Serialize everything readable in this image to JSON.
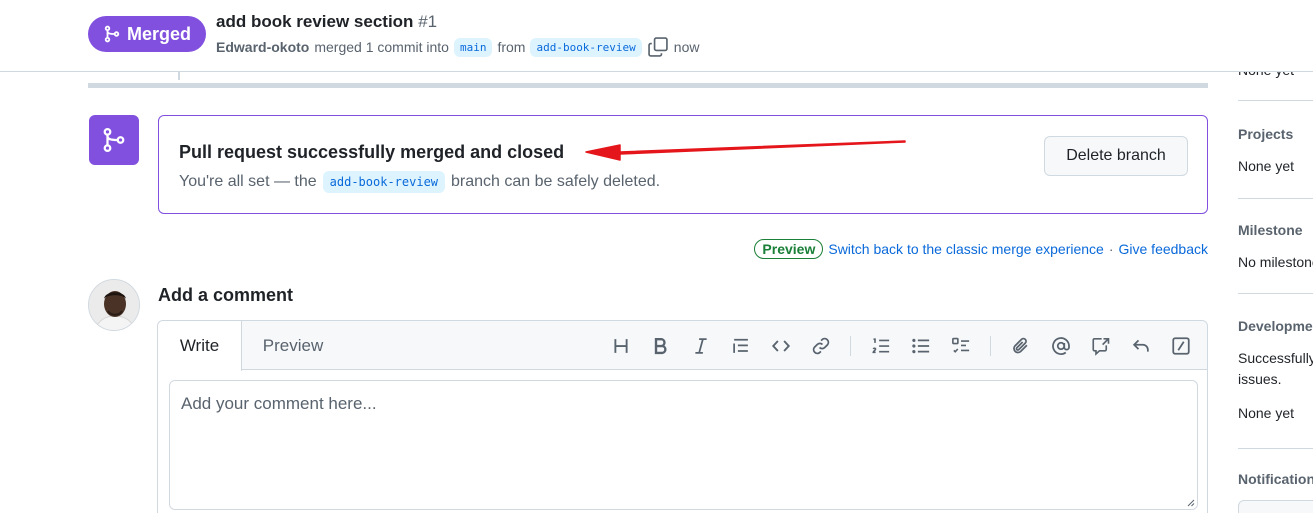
{
  "header": {
    "status_label": "Merged",
    "pr_title": "add book review section",
    "pr_number": "#1",
    "author": "Edward-okoto",
    "merged_text": "merged 1 commit into",
    "base_branch": "main",
    "from_text": "from",
    "head_branch": "add-book-review",
    "time": "now"
  },
  "merge_box": {
    "title": "Pull request successfully merged and closed",
    "desc_before": "You're all set — the",
    "branch": "add-book-review",
    "desc_after": "branch can be safely deleted.",
    "delete_button": "Delete branch"
  },
  "preview_bar": {
    "badge": "Preview",
    "switch_link": "Switch back to the classic merge experience",
    "separator": "·",
    "feedback_link": "Give feedback"
  },
  "comment": {
    "heading": "Add a comment",
    "tab_write": "Write",
    "tab_preview": "Preview",
    "placeholder": "Add your comment here...",
    "toolbar_icons": [
      "heading-icon",
      "bold-icon",
      "italic-icon",
      "quote-icon",
      "code-icon",
      "link-icon",
      "numbered-list-icon",
      "unordered-list-icon",
      "task-list-icon",
      "attach-icon",
      "mention-icon",
      "cross-reference-icon",
      "saved-reply-icon",
      "slash-command-icon"
    ]
  },
  "sidebar": {
    "top_value": "None yet",
    "projects_heading": "Projects",
    "projects_value": "None yet",
    "milestone_heading": "Milestone",
    "milestone_value": "No milestone",
    "development_heading": "Development",
    "development_text_1": "Successfully merging this pull request may close these",
    "development_text_2": "issues.",
    "development_value": "None yet",
    "notifications_heading": "Notifications"
  },
  "colors": {
    "merged_purple": "#8250df",
    "link_blue": "#0969da",
    "annotation_red": "#e5161b",
    "preview_green": "#1a7f37"
  }
}
